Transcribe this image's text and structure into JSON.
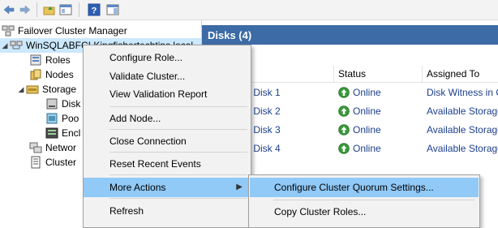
{
  "toolbar": {
    "icons": [
      "back-arrow-icon",
      "forward-arrow-icon",
      "up-folder-icon",
      "show-hide-console-tree-icon",
      "help-icon",
      "action-pane-icon"
    ]
  },
  "tree": {
    "root_label": "Failover Cluster Manager",
    "cluster_label": "WinSQLABFCI.Kingfishertechtips.local",
    "items": {
      "roles": "Roles",
      "nodes": "Nodes",
      "storage": "Storage",
      "disks": "Disk",
      "pools": "Poo",
      "enclosures": "Encl",
      "networks": "Networ",
      "cluster_events": "Cluster"
    }
  },
  "disks_pane": {
    "header": "Disks (4)",
    "columns": {
      "status": "Status",
      "assigned_to": "Assigned To"
    },
    "rows": [
      {
        "name": "r Disk 1",
        "status": "Online",
        "assigned": "Disk Witness in Qu"
      },
      {
        "name": "r Disk 2",
        "status": "Online",
        "assigned": "Available Storage"
      },
      {
        "name": "r Disk 3",
        "status": "Online",
        "assigned": "Available Storage"
      },
      {
        "name": "r Disk 4",
        "status": "Online",
        "assigned": "Available Storage"
      }
    ]
  },
  "context_menu": {
    "configure_role": "Configure Role...",
    "validate_cluster": "Validate Cluster...",
    "view_validation_report": "View Validation Report",
    "add_node": "Add Node...",
    "close_connection": "Close Connection",
    "reset_recent_events": "Reset Recent Events",
    "more_actions": "More Actions",
    "refresh": "Refresh"
  },
  "submenu": {
    "configure_quorum": "Configure Cluster Quorum Settings...",
    "copy_cluster_roles": "Copy Cluster Roles..."
  },
  "colors": {
    "header_blue": "#3c6ba5",
    "menu_highlight": "#91c9f7",
    "selection": "#cce8ff",
    "link_text": "#1c3f8c",
    "online_green": "#3a9a3a"
  }
}
